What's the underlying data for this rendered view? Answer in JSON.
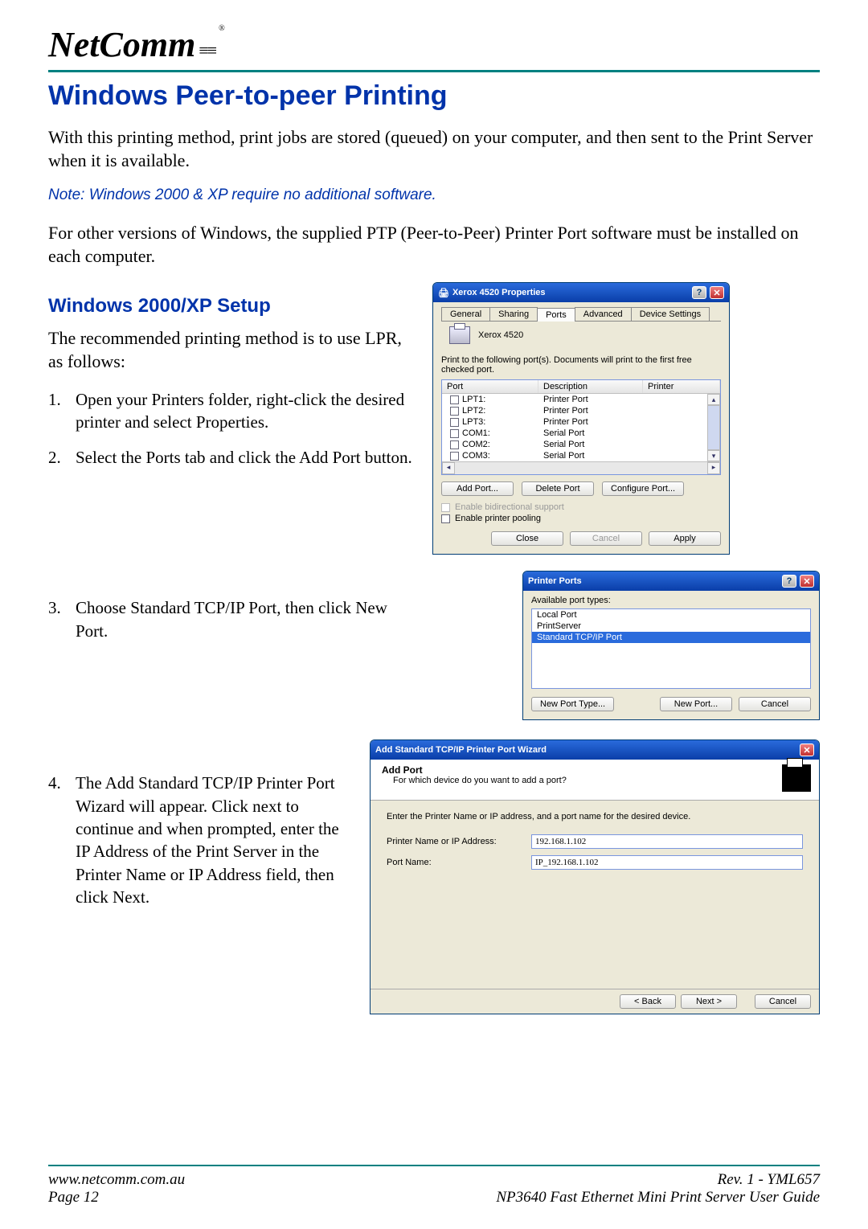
{
  "logo_text": "NetComm",
  "section_title": "Windows Peer-to-peer Printing",
  "intro_para": "With this printing method, print jobs are stored (queued) on your computer, and then sent to the Print Server when it is available.",
  "note_text": "Note:   Windows 2000 & XP require no additional software.",
  "para2": "For other versions of Windows, the supplied PTP (Peer-to-Peer) Printer Port software must be installed on each computer.",
  "subsection_title": "Windows 2000/XP Setup",
  "lead_text": "The recommended printing method is to use LPR, as follows:",
  "steps": {
    "s1_num": "1.",
    "s1": "Open your Printers folder, right-click the desired printer and select Properties.",
    "s2_num": "2.",
    "s2": "Select the Ports tab and click the Add Port button.",
    "s3_num": "3.",
    "s3": "Choose Standard TCP/IP Port, then click New Port.",
    "s4_num": "4.",
    "s4": "The Add Standard TCP/IP Printer Port Wizard will appear.  Click next to continue and when prompted,  enter the IP Address of the Print Server in the Printer Name or IP Address field, then click Next."
  },
  "dlg1": {
    "title": "Xerox 4520 Properties",
    "tabs": {
      "t1": "General",
      "t2": "Sharing",
      "t3": "Ports",
      "t4": "Advanced",
      "t5": "Device Settings"
    },
    "printer_name": "Xerox 4520",
    "instruction": "Print to the following port(s). Documents will print to the first free checked port.",
    "col_port": "Port",
    "col_desc": "Description",
    "col_printer": "Printer",
    "rows": [
      {
        "port": "LPT1:",
        "desc": "Printer Port"
      },
      {
        "port": "LPT2:",
        "desc": "Printer Port"
      },
      {
        "port": "LPT3:",
        "desc": "Printer Port"
      },
      {
        "port": "COM1:",
        "desc": "Serial Port"
      },
      {
        "port": "COM2:",
        "desc": "Serial Port"
      },
      {
        "port": "COM3:",
        "desc": "Serial Port"
      }
    ],
    "btn_add": "Add Port...",
    "btn_delete": "Delete Port",
    "btn_config": "Configure Port...",
    "chk_bidi": "Enable bidirectional support",
    "chk_pool": "Enable printer pooling",
    "btn_close": "Close",
    "btn_cancel": "Cancel",
    "btn_apply": "Apply"
  },
  "dlg2": {
    "title": "Printer Ports",
    "available_label": "Available port types:",
    "items": {
      "i1": "Local Port",
      "i2": "PrintServer",
      "i3": "Standard TCP/IP Port"
    },
    "btn_new_type": "New Port Type...",
    "btn_new_port": "New Port...",
    "btn_cancel": "Cancel"
  },
  "dlg3": {
    "title": "Add Standard TCP/IP Printer Port Wizard",
    "head_title": "Add Port",
    "head_sub": "For which device do you want to add a port?",
    "instruction": "Enter the Printer Name or IP address, and a port name for the desired device.",
    "label_ip": "Printer Name or IP Address:",
    "label_port": "Port Name:",
    "val_ip": "192.168.1.102",
    "val_port": "IP_192.168.1.102",
    "btn_back": "< Back",
    "btn_next": "Next >",
    "btn_cancel": "Cancel"
  },
  "footer": {
    "url": "www.netcomm.com.au",
    "rev": "Rev. 1 - YML657",
    "page": "Page 12",
    "guide": "NP3640  Fast Ethernet Mini Print Server User Guide"
  }
}
